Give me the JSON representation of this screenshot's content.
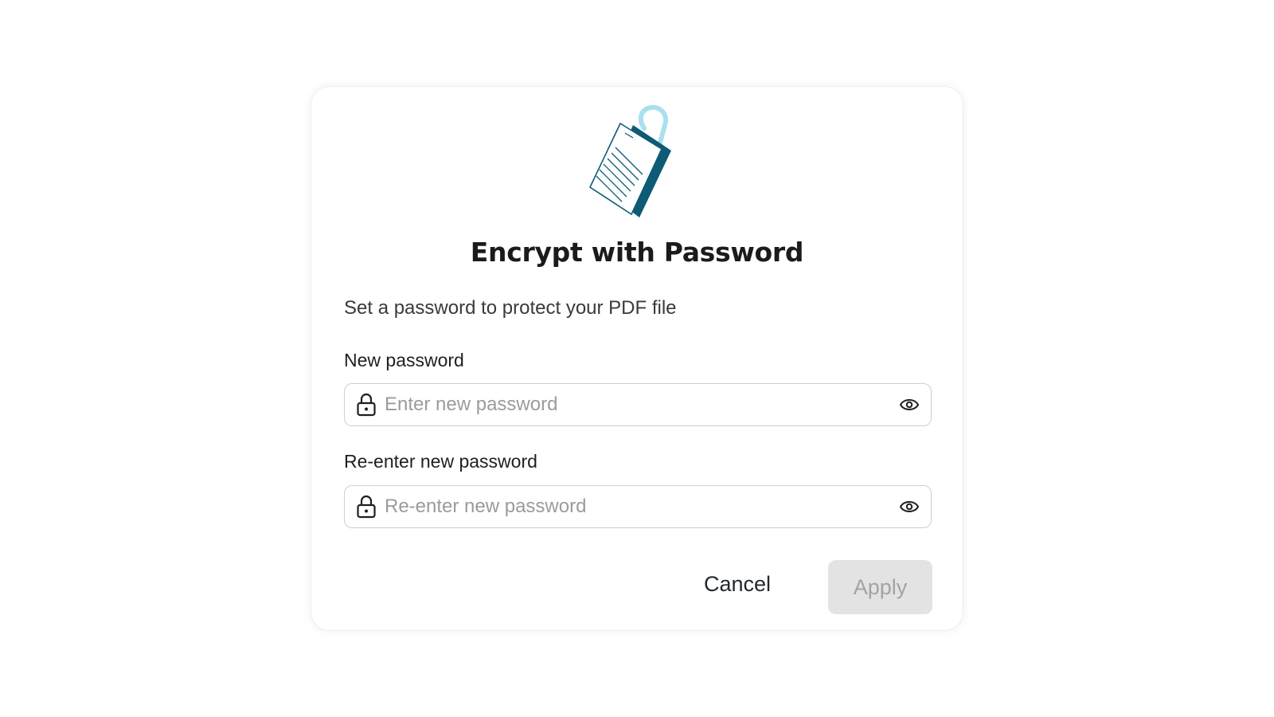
{
  "dialog": {
    "title": "Encrypt with Password",
    "subtitle": "Set a password to protect your PDF file",
    "illustration": "locked-document-icon"
  },
  "fields": [
    {
      "label": "New password",
      "placeholder": "Enter new password",
      "value": "",
      "leading_icon": "lock-icon",
      "trailing_icon": "eye-icon"
    },
    {
      "label": "Re-enter new password",
      "placeholder": "Re-enter new password",
      "value": "",
      "leading_icon": "lock-icon",
      "trailing_icon": "eye-icon"
    }
  ],
  "actions": {
    "cancel_label": "Cancel",
    "apply_label": "Apply",
    "apply_enabled": false
  },
  "colors": {
    "brand_dark": "#0d5b75",
    "brand_light": "#a9e0f0",
    "apply_bg_disabled": "#e3e3e3",
    "apply_text_disabled": "#a3a3a3"
  }
}
